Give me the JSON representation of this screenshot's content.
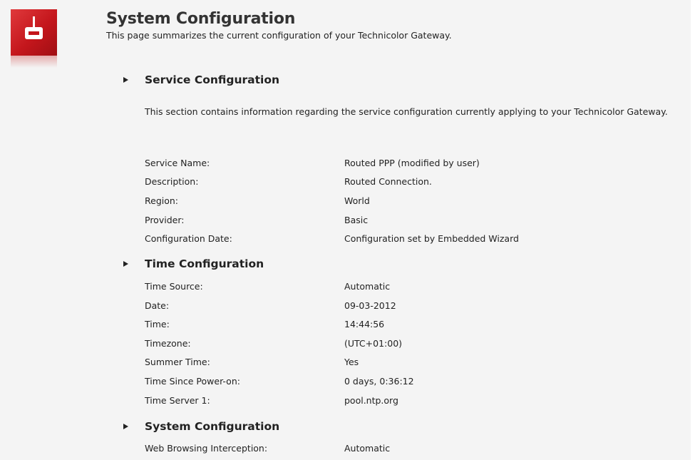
{
  "header": {
    "title": "System Configuration",
    "subtitle": "This page summarizes the current configuration of your Technicolor Gateway.",
    "logo_icon": "gateway-logo-icon",
    "brand_color": "#c4161c"
  },
  "service": {
    "heading": "Service Configuration",
    "description": "This section contains information regarding the service configuration currently applying to your Technicolor Gateway.",
    "rows": [
      {
        "label": "Service Name:",
        "value": "Routed PPP (modified by user)"
      },
      {
        "label": "Description:",
        "value": "Routed Connection."
      },
      {
        "label": "Region:",
        "value": "World"
      },
      {
        "label": "Provider:",
        "value": "Basic"
      },
      {
        "label": "Configuration Date:",
        "value": "Configuration set by Embedded Wizard"
      }
    ]
  },
  "time": {
    "heading": "Time Configuration",
    "rows": [
      {
        "label": "Time Source:",
        "value": "Automatic"
      },
      {
        "label": "Date:",
        "value": "09-03-2012"
      },
      {
        "label": "Time:",
        "value": "14:44:56"
      },
      {
        "label": "Timezone:",
        "value": "(UTC+01:00)"
      },
      {
        "label": "Summer Time:",
        "value": "Yes"
      },
      {
        "label": "Time Since Power-on:",
        "value": "0 days, 0:36:12"
      },
      {
        "label": "Time Server 1:",
        "value": "pool.ntp.org"
      }
    ]
  },
  "system": {
    "heading": "System Configuration",
    "rows": [
      {
        "label": "Web Browsing Interception:",
        "value": "Automatic"
      }
    ]
  }
}
